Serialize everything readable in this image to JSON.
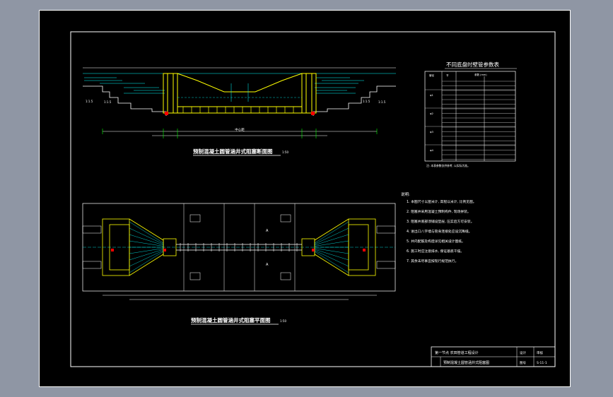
{
  "drawing": {
    "section_view": {
      "title": "预制混凝土圆管涵井式阻塞断面图",
      "scale": "1:50",
      "center_dim": "中心距"
    },
    "plan_view": {
      "title": "预制混凝土圆管涵井式阻塞平面图",
      "scale": "1:50",
      "cut_mark": "A",
      "cut_mark_b": "A"
    },
    "param_table": {
      "title": "不同底盘时壁管参数表",
      "headers": [
        "管径",
        "节",
        "参数 (mm)"
      ],
      "group_labels": [
        "φ1",
        "φ2",
        "φ3",
        "φ4"
      ],
      "note": "注: 本表参数仅供参考, 以实际为准。"
    },
    "notes": {
      "heading": "说明:",
      "items": [
        "1. 本图尺寸以厘米计, 高程以米计, 比例见图。",
        "2. 阻塞井采用混凝土预制构件, 现场拼装。",
        "3. 阻塞井底部须铺设垫层, 压实后方可安装。",
        "4. 进出口八字墙与管身连接处应设沉降缝。",
        "5. 井内配筋及构造详见相关设计图纸。",
        "6. 施工时应注意排水, 保证基底干燥。",
        "7. 其余未尽事宜按现行规范执行。"
      ]
    },
    "title_block": {
      "project": "第一节点  农田管道工程设计",
      "drawing_name": "预制混凝土圆管涵井式阻塞图",
      "sheet_label": "图号",
      "sheet_no": "S-11-1",
      "design_label": "设计",
      "review_label": "审核"
    }
  }
}
